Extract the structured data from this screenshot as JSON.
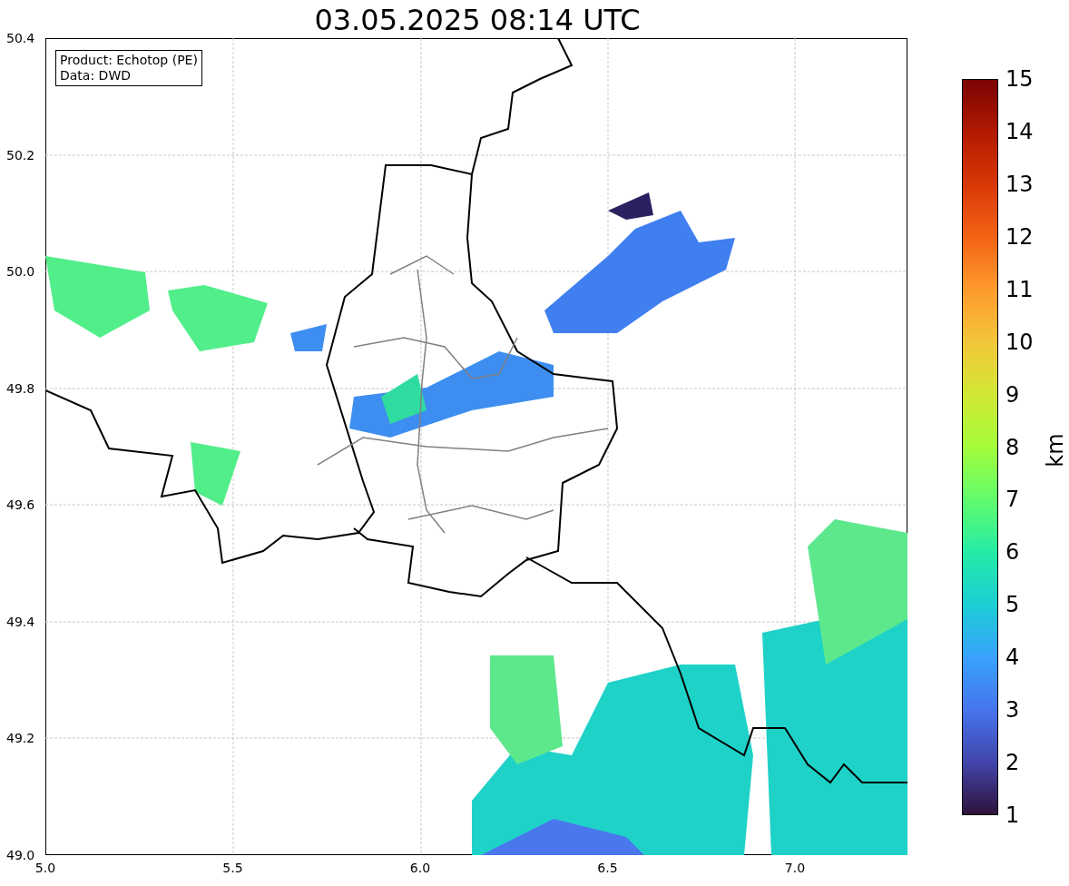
{
  "title": "03.05.2025 08:14 UTC",
  "info_box": [
    "Product: Echotop (PE)",
    "Data: DWD"
  ],
  "y_ticks": [
    "50.4",
    "50.2",
    "50.0",
    "49.8",
    "49.6",
    "49.4",
    "49.2",
    "49.0"
  ],
  "x_ticks": [
    "5.0",
    "5.5",
    "6.0",
    "6.5",
    "7.0"
  ],
  "colorbar": {
    "label": "km",
    "ticks": [
      "15",
      "14",
      "13",
      "12",
      "11",
      "10",
      "9",
      "8",
      "7",
      "6",
      "5",
      "4",
      "3",
      "2",
      "1"
    ]
  }
}
